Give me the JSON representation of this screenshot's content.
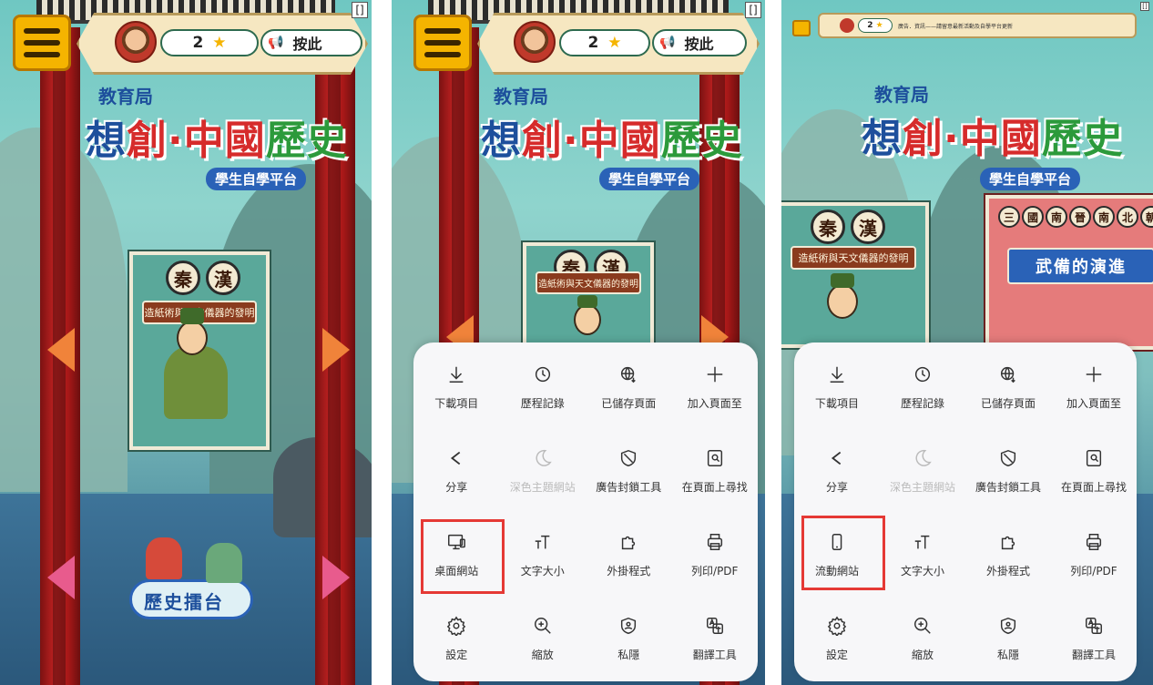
{
  "game": {
    "stars": "2",
    "press_label": "按此",
    "corner_icon": "[]",
    "edu_bureau": "教育局",
    "logo_a": "想",
    "logo_b": "創",
    "logo_dot": "·",
    "logo_c": "中國",
    "logo_d": "歷史",
    "subtitle": "學生自學平台",
    "card_dynasty_1": "秦",
    "card_dynasty_2": "漢",
    "card_banner": "造紙術與天文儀器的發明",
    "arena_label": "歷史擂台",
    "red_card_title": "武備的演進",
    "red_card_dynasties": [
      "三",
      "國",
      "南",
      "晉",
      "南",
      "北",
      "朝"
    ],
    "tiny_ticker": "廣告．資訊——請留意最新活動及自學平台更新"
  },
  "menus": {
    "panel2": [
      {
        "icon": "download-icon",
        "label": "下載項目"
      },
      {
        "icon": "history-icon",
        "label": "歷程記錄"
      },
      {
        "icon": "saved-pages-icon",
        "label": "已儲存頁面"
      },
      {
        "icon": "plus-icon",
        "label": "加入頁面至"
      },
      {
        "icon": "share-icon",
        "label": "分享"
      },
      {
        "icon": "moon-icon",
        "label": "深色主題網站"
      },
      {
        "icon": "adblock-icon",
        "label": "廣告封鎖工具"
      },
      {
        "icon": "find-icon",
        "label": "在頁面上尋找"
      },
      {
        "icon": "desktop-icon",
        "label": "桌面網站"
      },
      {
        "icon": "text-size-icon",
        "label": "文字大小"
      },
      {
        "icon": "extension-icon",
        "label": "外掛程式"
      },
      {
        "icon": "print-icon",
        "label": "列印/PDF"
      },
      {
        "icon": "settings-icon",
        "label": "設定"
      },
      {
        "icon": "zoom-icon",
        "label": "縮放"
      },
      {
        "icon": "privacy-icon",
        "label": "私隱"
      },
      {
        "icon": "translate-icon",
        "label": "翻譯工具"
      }
    ],
    "panel3": [
      {
        "icon": "download-icon",
        "label": "下載項目"
      },
      {
        "icon": "history-icon",
        "label": "歷程記錄"
      },
      {
        "icon": "saved-pages-icon",
        "label": "已儲存頁面"
      },
      {
        "icon": "plus-icon",
        "label": "加入頁面至"
      },
      {
        "icon": "share-icon",
        "label": "分享"
      },
      {
        "icon": "moon-icon",
        "label": "深色主題網站"
      },
      {
        "icon": "adblock-icon",
        "label": "廣告封鎖工具"
      },
      {
        "icon": "find-icon",
        "label": "在頁面上尋找"
      },
      {
        "icon": "mobile-icon",
        "label": "流動網站"
      },
      {
        "icon": "text-size-icon",
        "label": "文字大小"
      },
      {
        "icon": "extension-icon",
        "label": "外掛程式"
      },
      {
        "icon": "print-icon",
        "label": "列印/PDF"
      },
      {
        "icon": "settings-icon",
        "label": "設定"
      },
      {
        "icon": "zoom-icon",
        "label": "縮放"
      },
      {
        "icon": "privacy-icon",
        "label": "私隱"
      },
      {
        "icon": "translate-icon",
        "label": "翻譯工具"
      }
    ]
  },
  "colors": {
    "highlight": "#e53935",
    "accent_gold": "#f5b400",
    "pillar_red": "#c52222"
  }
}
